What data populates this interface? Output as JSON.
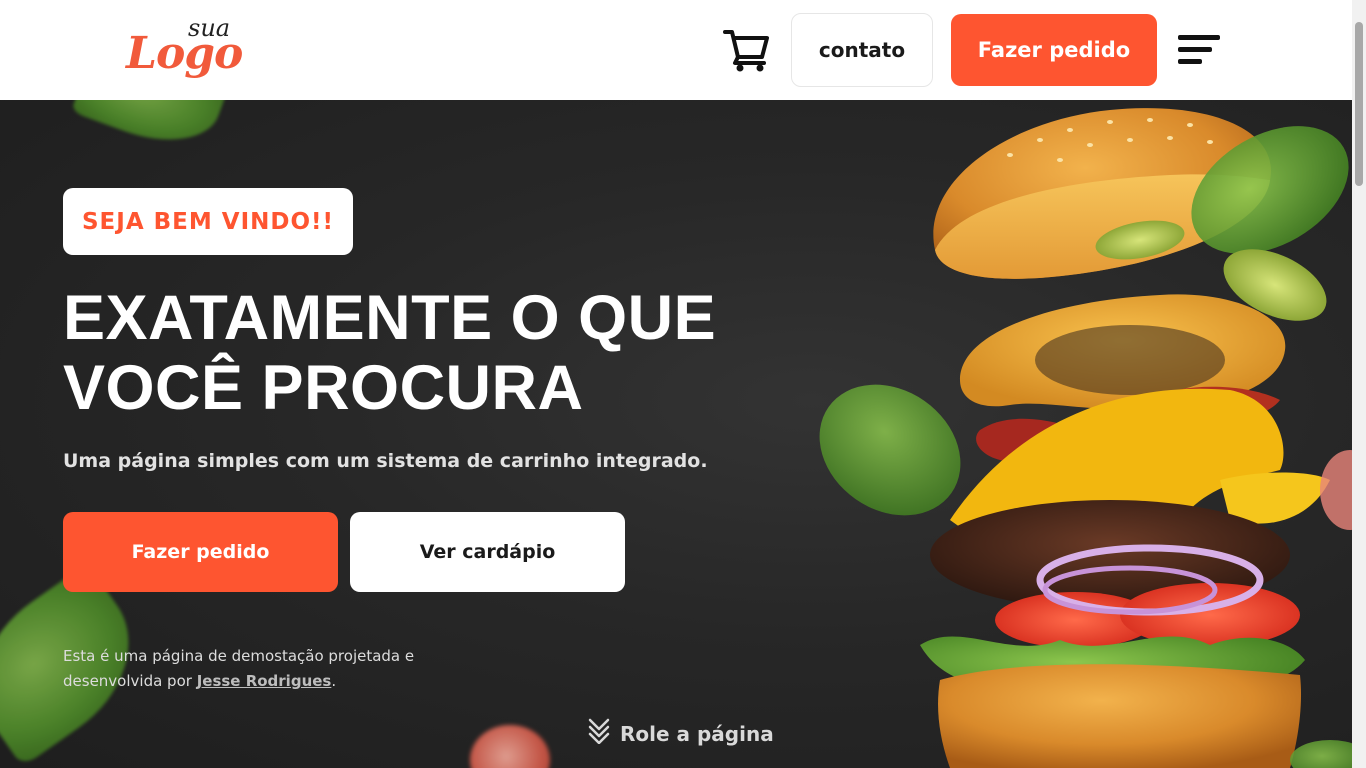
{
  "header": {
    "logo_small": "sua",
    "logo_big": "Logo",
    "cart_icon": "shopping-cart-icon",
    "contact_label": "contato",
    "order_label": "Fazer pedido",
    "menu_icon": "hamburger-menu-icon"
  },
  "hero": {
    "badge": "SEJA BEM VINDO!!",
    "headline_line1": "EXATAMENTE O QUE",
    "headline_line2": "VOCÊ PROCURA",
    "subtitle": "Uma página simples com um sistema de carrinho integrado.",
    "primary_button": "Fazer pedido",
    "secondary_button": "Ver cardápio",
    "credit_prefix": "Esta é uma página de demostação projetada e desenvolvida por ",
    "credit_author": "Jesse Rodrigues",
    "credit_suffix": ".",
    "scroll_label": "Role a página",
    "scroll_icon": "double-chevron-down-icon"
  },
  "colors": {
    "accent": "#fe5530",
    "background": "#222222",
    "white": "#ffffff"
  }
}
